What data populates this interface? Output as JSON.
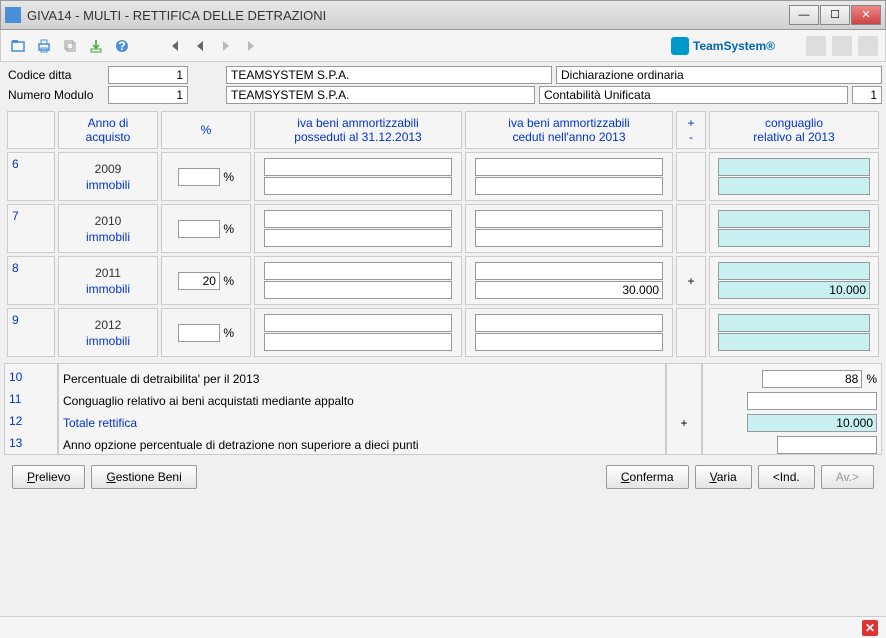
{
  "window": {
    "title": "GIVA14  -  MULTI  -   RETTIFICA DELLE DETRAZIONI",
    "brand": "TeamSystem®"
  },
  "info": {
    "codice_label": "Codice ditta",
    "codice_val": "1",
    "company1": "TEAMSYSTEM S.P.A.",
    "dich_type": "Dichiarazione ordinaria",
    "modulo_label": "Numero Modulo",
    "modulo_val": "1",
    "company2": "TEAMSYSTEM S.P.A.",
    "contab": "Contabilità Unificata",
    "contab_n": "1"
  },
  "headers": {
    "c1_l1": "Anno di",
    "c1_l2": "acquisto",
    "c2": "%",
    "c3_l1": "iva beni ammortizzabili",
    "c3_l2": "posseduti al 31.12.2013",
    "c4_l1": "iva beni ammortizzabili",
    "c4_l2": "ceduti nell'anno 2013",
    "c5_l1": "+",
    "c5_l2": "-",
    "c6_l1": "conguaglio",
    "c6_l2": "relativo al 2013"
  },
  "rows": [
    {
      "idx": "6",
      "year": "2009",
      "type": "immobili",
      "pct": "",
      "a1": "",
      "a2": "",
      "b1": "",
      "b2": "",
      "sign": "",
      "c1": "",
      "c2": ""
    },
    {
      "idx": "7",
      "year": "2010",
      "type": "immobili",
      "pct": "",
      "a1": "",
      "a2": "",
      "b1": "",
      "b2": "",
      "sign": "",
      "c1": "",
      "c2": ""
    },
    {
      "idx": "8",
      "year": "2011",
      "type": "immobili",
      "pct": "20",
      "a1": "",
      "a2": "",
      "b1": "",
      "b2": "30.000",
      "sign": "+",
      "c1": "",
      "c2": "10.000"
    },
    {
      "idx": "9",
      "year": "2012",
      "type": "immobili",
      "pct": "",
      "a1": "",
      "a2": "",
      "b1": "",
      "b2": "",
      "sign": "",
      "c1": "",
      "c2": ""
    }
  ],
  "summary": {
    "i10": "10",
    "t10": "Percentuale di detraibilita' per il 2013",
    "v10": "88",
    "v10_suffix": "%",
    "i11": "11",
    "t11": "Conguaglio relativo ai beni acquistati mediante appalto",
    "v11": "",
    "i12": "12",
    "t12": "Totale rettifica",
    "sign12": "+",
    "v12": "10.000",
    "i13": "13",
    "t13": "Anno opzione percentuale di detrazione non superiore a dieci punti",
    "v13": ""
  },
  "buttons": {
    "prelievo": "Prelievo",
    "gestione": "Gestione Beni",
    "conferma": "Conferma",
    "varia": "Varia",
    "ind": "<Ind.",
    "av": "Av.>"
  }
}
